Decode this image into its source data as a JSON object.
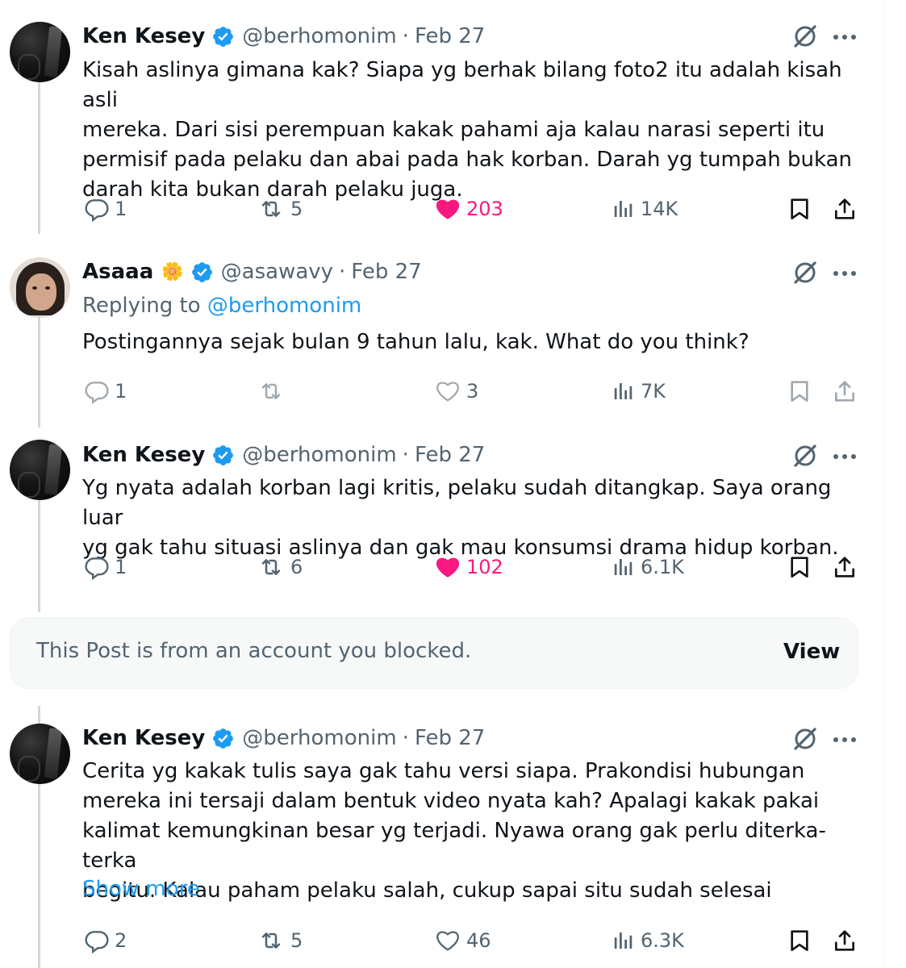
{
  "posts": [
    {
      "author": "Ken Kesey",
      "handle": "@berhomonim",
      "separator": "·",
      "date": "Feb 27",
      "verified": true,
      "lines": [
        "Kisah aslinya gimana kak? Siapa yg berhak bilang foto2 itu adalah kisah asli",
        "mereka. Dari sisi perempuan kakak pahami aja kalau narasi seperti itu",
        "permisif pada pelaku dan abai pada hak korban. Darah yg tumpah bukan",
        "darah kita bukan darah pelaku juga."
      ],
      "replies": "1",
      "reposts": "5",
      "likes": "203",
      "liked": true,
      "views": "14K"
    },
    {
      "author": "Asaaa",
      "emoji": "🌼",
      "handle": "@asawavy",
      "separator": "·",
      "date": "Feb 27",
      "verified": true,
      "replying_prefix": "Replying to",
      "replying_to": "@berhomonim",
      "lines": [
        "Postingannya sejak bulan 9 tahun lalu, kak. What do you think?"
      ],
      "replies": "1",
      "reposts": "",
      "likes": "3",
      "liked": false,
      "views": "7K"
    },
    {
      "author": "Ken Kesey",
      "handle": "@berhomonim",
      "separator": "·",
      "date": "Feb 27",
      "verified": true,
      "lines": [
        "Yg nyata adalah korban lagi kritis, pelaku sudah ditangkap. Saya orang luar",
        "yg gak tahu situasi aslinya dan gak mau konsumsi drama hidup korban."
      ],
      "replies": "1",
      "reposts": "6",
      "likes": "102",
      "liked": true,
      "views": "6.1K"
    },
    {
      "author": "Ken Kesey",
      "handle": "@berhomonim",
      "separator": "·",
      "date": "Feb 27",
      "verified": true,
      "lines": [
        "Cerita yg kakak tulis saya gak tahu versi siapa. Prakondisi hubungan",
        "mereka ini tersaji dalam bentuk video nyata kah? Apalagi kakak pakai",
        "kalimat kemungkinan besar yg terjadi. Nyawa orang gak perlu diterka-terka",
        "begitu. Kalau paham pelaku salah, cukup sapai situ sudah selesai"
      ],
      "show_more": "Show more",
      "replies": "2",
      "reposts": "5",
      "likes": "46",
      "liked": false,
      "views": "6.3K"
    }
  ],
  "blocked_notice": {
    "text": "This Post is from an account you blocked.",
    "action": "View"
  },
  "colors": {
    "text": "#0f1419",
    "secondary": "#536471",
    "link": "#1d9bf0",
    "like": "#f91880",
    "verified": "#1d9bf0",
    "thread_line": "#cfd9de"
  },
  "icons": [
    "verified-badge-icon",
    "grok-slash-icon",
    "more-icon",
    "reply-icon",
    "repost-icon",
    "like-icon",
    "views-icon",
    "bookmark-icon",
    "share-icon"
  ]
}
